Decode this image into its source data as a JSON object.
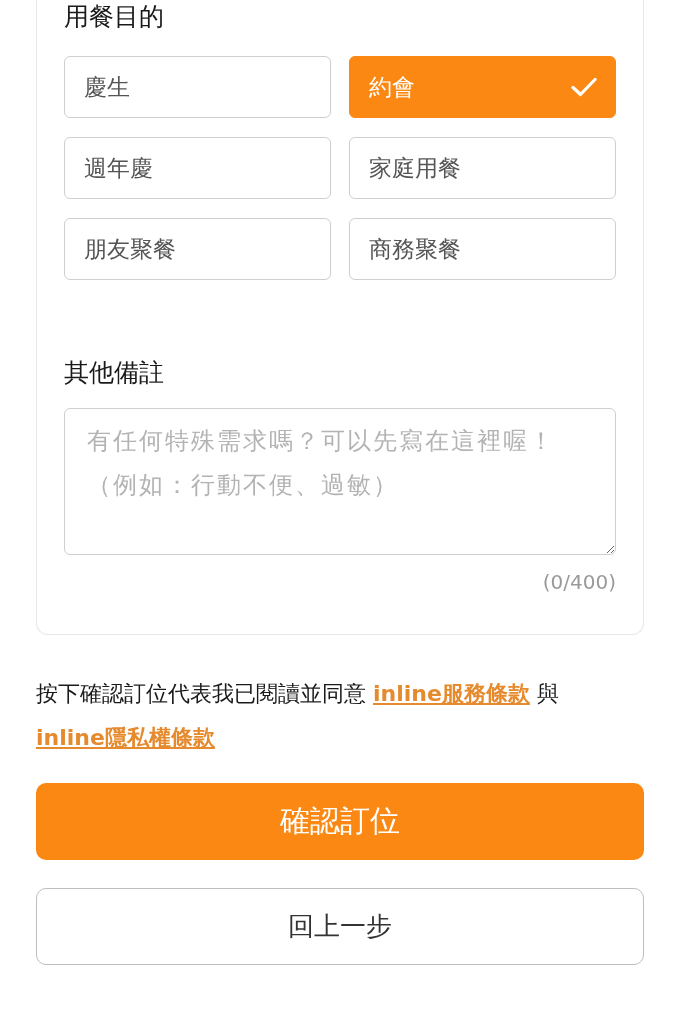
{
  "purpose": {
    "label": "用餐目的",
    "options": [
      {
        "label": "慶生",
        "selected": false
      },
      {
        "label": "約會",
        "selected": true
      },
      {
        "label": "週年慶",
        "selected": false
      },
      {
        "label": "家庭用餐",
        "selected": false
      },
      {
        "label": "朋友聚餐",
        "selected": false
      },
      {
        "label": "商務聚餐",
        "selected": false
      }
    ]
  },
  "notes": {
    "label": "其他備註",
    "placeholder": "有任何特殊需求嗎？可以先寫在這裡喔！（例如：行動不便、過敏）",
    "counter": "(0/400)"
  },
  "agreement": [
    {
      "kind": "text",
      "text": "按下確認訂位代表我已閱讀並同意"
    },
    {
      "kind": "link",
      "text": "inline服務條款"
    },
    {
      "kind": "text",
      "text": "與"
    },
    {
      "kind": "link",
      "text": "inline隱私權條款"
    }
  ],
  "buttons": [
    {
      "kind": "primary",
      "label": "確認訂位"
    },
    {
      "kind": "secondary",
      "label": "回上一步"
    }
  ]
}
